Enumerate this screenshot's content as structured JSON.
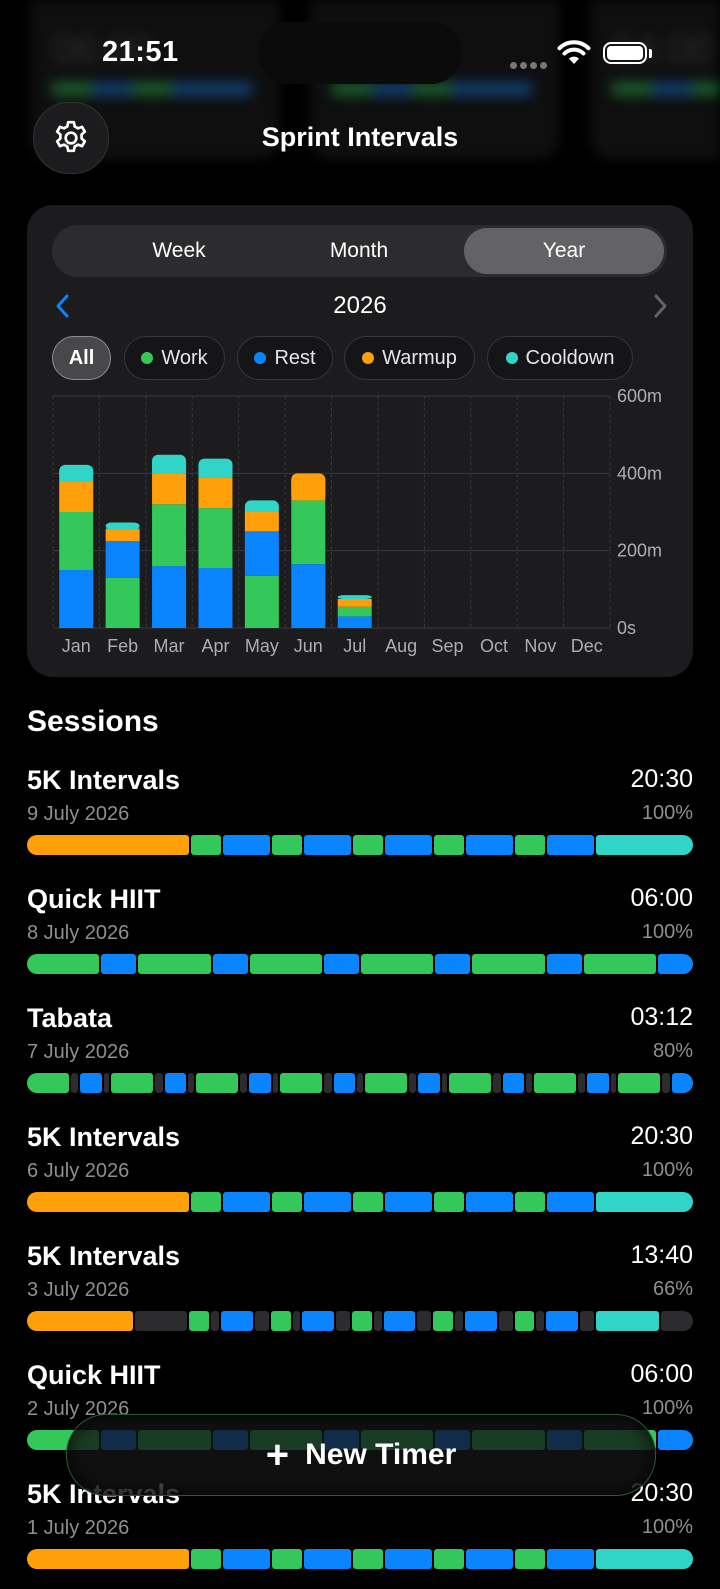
{
  "status_bar": {
    "time": "21:51"
  },
  "header": {
    "title": "Sprint Intervals",
    "settings_icon": "gear-icon"
  },
  "stats": {
    "period_options": [
      "Week",
      "Month",
      "Year"
    ],
    "selected_period": "Year",
    "year": "2026",
    "filters": [
      {
        "label": "All",
        "color": null,
        "active": true
      },
      {
        "label": "Work",
        "color": "#34c759",
        "active": false
      },
      {
        "label": "Rest",
        "color": "#0a84ff",
        "active": false
      },
      {
        "label": "Warmup",
        "color": "#ff9f0a",
        "active": false
      },
      {
        "label": "Cooldown",
        "color": "#30d5c8",
        "active": false
      }
    ]
  },
  "chart_data": {
    "type": "bar",
    "stacked": true,
    "categories": [
      "Jan",
      "Feb",
      "Mar",
      "Apr",
      "May",
      "Jun",
      "Jul",
      "Aug",
      "Sep",
      "Oct",
      "Nov",
      "Dec"
    ],
    "series": [
      {
        "name": "Rest",
        "color": "#0a84ff",
        "values": [
          150,
          0,
          160,
          155,
          0,
          165,
          30,
          0,
          0,
          0,
          0,
          0
        ]
      },
      {
        "name": "Work",
        "color": "#34c759",
        "values": [
          150,
          130,
          160,
          155,
          135,
          165,
          25,
          0,
          0,
          0,
          0,
          0
        ]
      },
      {
        "name": "Warmup",
        "color": "#ff9f0a",
        "values": [
          80,
          0,
          80,
          80,
          0,
          70,
          20,
          0,
          0,
          0,
          0,
          0
        ]
      },
      {
        "name": "Cooldown",
        "color": "#30d5c8",
        "values": [
          42,
          0,
          48,
          48,
          0,
          0,
          10,
          0,
          0,
          0,
          0,
          0
        ]
      }
    ],
    "series_feb_may": {
      "Feb": {
        "Work": 130,
        "Rest": 95,
        "Warmup": 30,
        "Cooldown": 18
      },
      "May": {
        "Work": 135,
        "Rest": 115,
        "Warmup": 50,
        "Cooldown": 30
      }
    },
    "y_ticks": [
      "600m",
      "400m",
      "200m",
      "0s"
    ],
    "ylim": [
      0,
      600
    ],
    "grid": true
  },
  "sessions": {
    "title": "Sessions",
    "items": [
      {
        "name": "5K Intervals",
        "date": "9 July 2026",
        "duration": "20:30",
        "percent": "100%",
        "bar": "5k"
      },
      {
        "name": "Quick HIIT",
        "date": "8 July 2026",
        "duration": "06:00",
        "percent": "100%",
        "bar": "hiit"
      },
      {
        "name": "Tabata",
        "date": "7 July 2026",
        "duration": "03:12",
        "percent": "80%",
        "bar": "tabata"
      },
      {
        "name": "5K Intervals",
        "date": "6 July 2026",
        "duration": "20:30",
        "percent": "100%",
        "bar": "5k"
      },
      {
        "name": "5K Intervals",
        "date": "3 July 2026",
        "duration": "13:40",
        "percent": "66%",
        "bar": "5k-partial"
      },
      {
        "name": "Quick HIIT",
        "date": "2 July 2026",
        "duration": "06:00",
        "percent": "100%",
        "bar": "hiit"
      },
      {
        "name": "5K Intervals",
        "date": "1 July 2026",
        "duration": "20:30",
        "percent": "100%",
        "bar": "5k"
      }
    ]
  },
  "new_timer_button": {
    "label": "New Timer",
    "icon": "plus-icon"
  }
}
